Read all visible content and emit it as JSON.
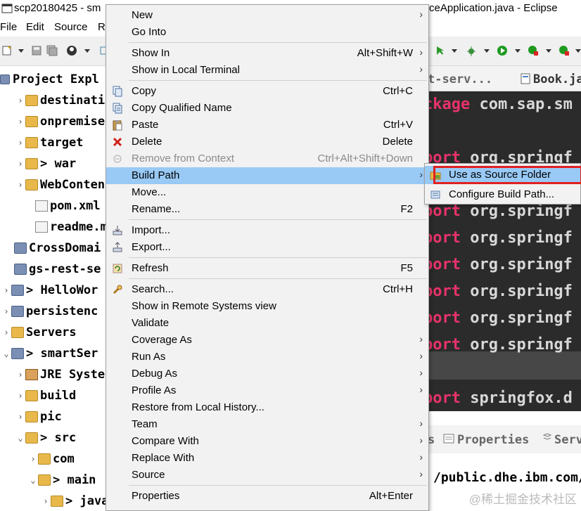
{
  "window": {
    "title_left": "scp20180425 - sm",
    "title_right": "ceApplication.java - Eclipse"
  },
  "menubar": [
    "File",
    "Edit",
    "Source",
    "R"
  ],
  "explorer": {
    "tab_label": "Project Expl",
    "rows": [
      {
        "label": "destinati",
        "icon": "folder-icon",
        "arrow": "›"
      },
      {
        "label": "onpremise",
        "icon": "folder-icon",
        "arrow": "›"
      },
      {
        "label": "target",
        "icon": "folder-icon",
        "arrow": "›"
      },
      {
        "label": "> war",
        "icon": "folder-icon",
        "arrow": "›"
      },
      {
        "label": "WebConten",
        "icon": "folder-icon",
        "arrow": "›"
      },
      {
        "label": "pom.xml",
        "icon": "xml-file-icon",
        "arrow": ""
      },
      {
        "label": "readme.md",
        "icon": "text-file-icon",
        "arrow": ""
      },
      {
        "label": "CrossDomai",
        "icon": "project-icon",
        "arrow": ""
      },
      {
        "label": "gs-rest-se",
        "icon": "project-icon",
        "arrow": ""
      },
      {
        "label": "> HelloWor",
        "icon": "maven-project-icon",
        "arrow": "›"
      },
      {
        "label": "persistenc",
        "icon": "project-icon",
        "arrow": "›"
      },
      {
        "label": "Servers",
        "icon": "folder-icon",
        "arrow": "›"
      },
      {
        "label": "> smartSer",
        "icon": "maven-project-icon",
        "arrow": "⌄"
      },
      {
        "label": "JRE Syste",
        "icon": "library-icon",
        "arrow": "›"
      },
      {
        "label": "build",
        "icon": "folder-icon",
        "arrow": "›"
      },
      {
        "label": "pic",
        "icon": "folder-icon",
        "arrow": "›"
      },
      {
        "label": "> src",
        "icon": "folder-icon",
        "arrow": "⌄"
      },
      {
        "label": "com",
        "icon": "folder-icon",
        "arrow": "›"
      },
      {
        "label": "> main",
        "icon": "folder-icon",
        "arrow": "⌄"
      },
      {
        "label": "> java",
        "icon": "folder-icon",
        "arrow": "›"
      }
    ]
  },
  "editor": {
    "tabs": [
      "t-serv...",
      "Book.ja"
    ],
    "lines": [
      {
        "kw": "ckage",
        "rest": " com.sap.sm"
      },
      {
        "kw": "",
        "rest": ""
      },
      {
        "kw": "port",
        "rest": " org.springf"
      },
      {
        "kw": "",
        "rest": ""
      },
      {
        "kw": "port",
        "rest": " org.springf"
      },
      {
        "kw": "port",
        "rest": " org.springf"
      },
      {
        "kw": "port",
        "rest": " org.springf"
      },
      {
        "kw": "port",
        "rest": " org.springf"
      },
      {
        "kw": "port",
        "rest": " org.springf"
      },
      {
        "kw": "port",
        "rest": " org.springf"
      },
      {
        "kw": "",
        "rest": ""
      },
      {
        "kw": "port",
        "rest": " springfox.d"
      }
    ]
  },
  "bottom_panel": {
    "tabs": [
      "s",
      "Properties",
      "Serv"
    ],
    "console_text": "/public.dhe.ibm.com/"
  },
  "watermark": "@稀土掘金技术社区",
  "context_menu": {
    "items": [
      {
        "label": "New",
        "accel": "",
        "submenu": true,
        "icon": ""
      },
      {
        "label": "Go Into",
        "accel": "",
        "submenu": false,
        "icon": ""
      },
      {
        "sep": true
      },
      {
        "label": "Show In",
        "accel": "Alt+Shift+W",
        "submenu": true,
        "icon": ""
      },
      {
        "label": "Show in Local Terminal",
        "accel": "",
        "submenu": true,
        "icon": ""
      },
      {
        "sep": true
      },
      {
        "label": "Copy",
        "accel": "Ctrl+C",
        "submenu": false,
        "icon": "copy-icon"
      },
      {
        "label": "Copy Qualified Name",
        "accel": "",
        "submenu": false,
        "icon": "copy-qualified-icon"
      },
      {
        "label": "Paste",
        "accel": "Ctrl+V",
        "submenu": false,
        "icon": "paste-icon"
      },
      {
        "label": "Delete",
        "accel": "Delete",
        "submenu": false,
        "icon": "delete-icon"
      },
      {
        "label": "Remove from Context",
        "accel": "Ctrl+Alt+Shift+Down",
        "submenu": false,
        "icon": "remove-context-icon",
        "disabled": true
      },
      {
        "label": "Build Path",
        "accel": "",
        "submenu": true,
        "icon": "",
        "active": true
      },
      {
        "label": "Move...",
        "accel": "",
        "submenu": false,
        "icon": ""
      },
      {
        "label": "Rename...",
        "accel": "F2",
        "submenu": false,
        "icon": ""
      },
      {
        "sep": true
      },
      {
        "label": "Import...",
        "accel": "",
        "submenu": false,
        "icon": "import-icon"
      },
      {
        "label": "Export...",
        "accel": "",
        "submenu": false,
        "icon": "export-icon"
      },
      {
        "sep": true
      },
      {
        "label": "Refresh",
        "accel": "F5",
        "submenu": false,
        "icon": "refresh-icon"
      },
      {
        "sep": true
      },
      {
        "label": "Search...",
        "accel": "Ctrl+H",
        "submenu": false,
        "icon": "search-icon"
      },
      {
        "label": "Show in Remote Systems view",
        "accel": "",
        "submenu": false,
        "icon": ""
      },
      {
        "label": "Validate",
        "accel": "",
        "submenu": false,
        "icon": ""
      },
      {
        "label": "Coverage As",
        "accel": "",
        "submenu": true,
        "icon": ""
      },
      {
        "label": "Run As",
        "accel": "",
        "submenu": true,
        "icon": ""
      },
      {
        "label": "Debug As",
        "accel": "",
        "submenu": true,
        "icon": ""
      },
      {
        "label": "Profile As",
        "accel": "",
        "submenu": true,
        "icon": ""
      },
      {
        "label": "Restore from Local History...",
        "accel": "",
        "submenu": false,
        "icon": ""
      },
      {
        "label": "Team",
        "accel": "",
        "submenu": true,
        "icon": ""
      },
      {
        "label": "Compare With",
        "accel": "",
        "submenu": true,
        "icon": ""
      },
      {
        "label": "Replace With",
        "accel": "",
        "submenu": true,
        "icon": ""
      },
      {
        "label": "Source",
        "accel": "",
        "submenu": true,
        "icon": ""
      },
      {
        "sep": true
      },
      {
        "label": "Properties",
        "accel": "Alt+Enter",
        "submenu": false,
        "icon": ""
      }
    ]
  },
  "build_path_submenu": {
    "items": [
      {
        "label": "Use as Source Folder",
        "icon": "source-folder-icon",
        "active": true
      },
      {
        "label": "Configure Build Path...",
        "icon": "build-path-icon"
      }
    ]
  },
  "colors": {
    "menu_bg": "#f2f2f2",
    "menu_highlight": "#99c9f5",
    "editor_bg": "#2b2b2b",
    "keyword": "#e8336a",
    "annotation_red": "#e02020"
  }
}
